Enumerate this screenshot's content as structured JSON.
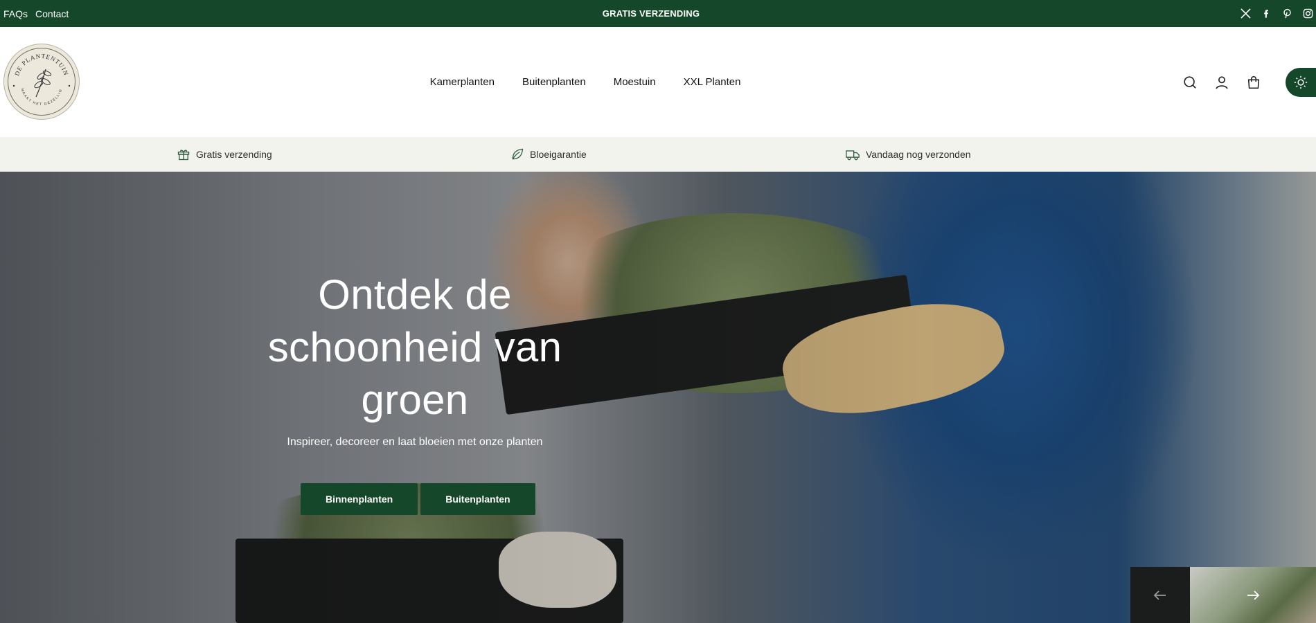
{
  "topbar": {
    "links": [
      "FAQs",
      "Contact"
    ],
    "announcement": "GRATIS VERZENDING",
    "social_icons": [
      "x-icon",
      "facebook-icon",
      "pinterest-icon",
      "instagram-icon"
    ]
  },
  "header": {
    "logo": {
      "name": "DE PLANTENTUIN",
      "tagline": "MAAKT HET GEZELLIG"
    },
    "nav": [
      "Kamerplanten",
      "Buitenplanten",
      "Moestuin",
      "XXL Planten"
    ],
    "icons": [
      "search-icon",
      "account-icon",
      "cart-icon",
      "sun-icon"
    ]
  },
  "usp": [
    {
      "icon": "gift-icon",
      "label": "Gratis verzending"
    },
    {
      "icon": "leaf-icon",
      "label": "Bloeigarantie"
    },
    {
      "icon": "truck-icon",
      "label": "Vandaag nog verzonden"
    }
  ],
  "hero": {
    "title": "Ontdek de schoonheid van groen",
    "subtitle": "Inspireer, decoreer en laat bloeien met onze planten",
    "buttons": [
      "Binnenplanten",
      "Buitenplanten"
    ],
    "slider_icons": [
      "arrow-left-icon",
      "arrow-right-icon"
    ]
  },
  "colors": {
    "brand_green": "#15472a",
    "usp_background": "#f3f3ee",
    "text_dark": "#111111"
  }
}
